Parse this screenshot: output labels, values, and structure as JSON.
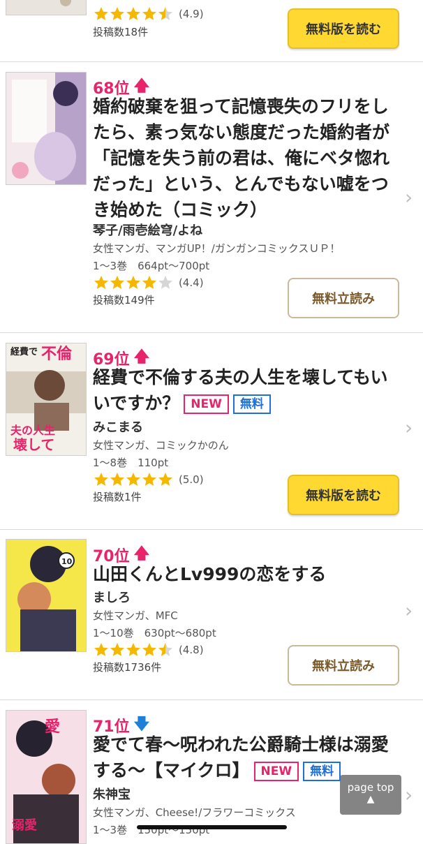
{
  "top_item": {
    "rating": "(4.9)",
    "stars": 4.5,
    "posts": "投稿数18件",
    "button": "無料版を読む"
  },
  "items": [
    {
      "rank": "68位",
      "trend": "up",
      "title": "婚約破棄を狙って記憶喪失のフリをしたら、素っ気ない態度だった婚約者が「記憶を失う前の君は、俺にベタ惚れだった」という、とんでもない嘘をつき始めた（コミック）",
      "author": "琴子/雨壱絵穹/よね",
      "genre": "女性マンガ、マンガUP！/ガンガンコミックスＵＰ！",
      "volumes": "1～3巻　664pt～700pt",
      "stars": 4,
      "rating": "(4.4)",
      "posts": "投稿数149件",
      "button": "無料立読み"
    },
    {
      "rank": "69位",
      "trend": "up",
      "title": "経費で不倫する夫の人生を壊してもいいですか？",
      "tag_new": "NEW",
      "tag_free": "無料",
      "author": "みこまる",
      "genre": "女性マンガ、コミックかのん",
      "volumes": "1～8巻　110pt",
      "stars": 5,
      "rating": "(5.0)",
      "posts": "投稿数1件",
      "button": "無料版を読む",
      "cover_text": "経費で不倫する夫の人生を壊してもいいですか？"
    },
    {
      "rank": "70位",
      "trend": "up",
      "title": "山田くんとLv999の恋をする",
      "author": "ましろ",
      "genre": "女性マンガ、MFC",
      "volumes": "1～10巻　630pt～680pt",
      "stars": 4.5,
      "rating": "(4.8)",
      "posts": "投稿数1736件",
      "button": "無料立読み",
      "cover_text": "10"
    },
    {
      "rank": "71位",
      "trend": "down",
      "title": "愛でて春～呪われた公爵騎士様は溺愛する～【マイクロ】",
      "tag_new": "NEW",
      "tag_free": "無料",
      "author": "朱神宝",
      "genre": "女性マンガ、Cheese!/フラワーコミックス",
      "volumes": "1～3巻　150pt～150pt"
    }
  ],
  "page_top": "page top",
  "colors": {
    "rank": "#e8236b",
    "up": "#e8236b",
    "down": "#1e7fd8",
    "star": "#f5b800",
    "button_yellow": "#ffd932"
  }
}
